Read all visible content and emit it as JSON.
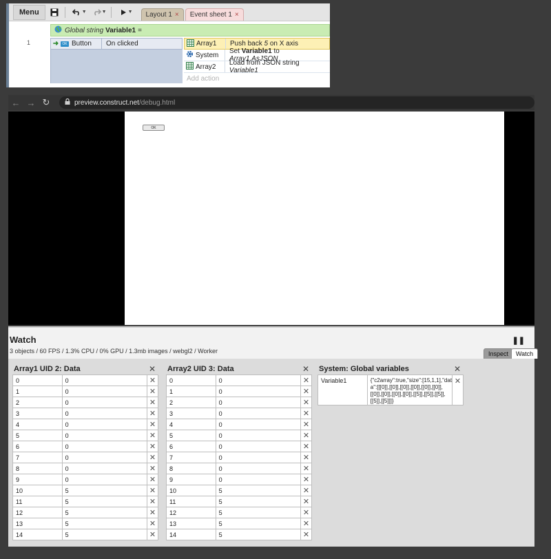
{
  "editor": {
    "menu_label": "Menu",
    "tabs": [
      {
        "label": "Layout 1"
      },
      {
        "label": "Event sheet 1"
      }
    ],
    "tab_close_glyph": "×",
    "global_var": {
      "prefix": "Global string",
      "name": "Variable1",
      "suffix": "="
    },
    "event": {
      "number": "1",
      "condition": {
        "object": "Button",
        "icon_label": "OK",
        "text": "On clicked"
      },
      "actions": [
        {
          "object": "Array1",
          "icon": "array-icon",
          "pre": "Push back",
          "mid": "5",
          "post": "on X axis"
        },
        {
          "object": "System",
          "icon": "gear-icon",
          "pre": "Set",
          "mid": "Variable1",
          "post": "to",
          "expr": "Array1.AsJSON"
        },
        {
          "object": "Array2",
          "icon": "array-icon",
          "pre": "Load from JSON string",
          "expr": "Variable1"
        }
      ],
      "add_action": "Add action"
    }
  },
  "browser": {
    "url_host": "preview.construct.net",
    "url_path": "/debug.html",
    "game_button_label": "OK"
  },
  "debugger": {
    "title": "Watch",
    "stats": "3 objects / 60 FPS / 1.3% CPU / 0% GPU / 1.3mb images / webgl2 / Worker",
    "tabs": {
      "inspect": "Inspect",
      "watch": "Watch"
    },
    "close_glyph": "✕",
    "panels": [
      {
        "title": "Array1 UID 2: Data",
        "rows": [
          {
            "k": "0",
            "v": "0"
          },
          {
            "k": "1",
            "v": "0"
          },
          {
            "k": "2",
            "v": "0"
          },
          {
            "k": "3",
            "v": "0"
          },
          {
            "k": "4",
            "v": "0"
          },
          {
            "k": "5",
            "v": "0"
          },
          {
            "k": "6",
            "v": "0"
          },
          {
            "k": "7",
            "v": "0"
          },
          {
            "k": "8",
            "v": "0"
          },
          {
            "k": "9",
            "v": "0"
          },
          {
            "k": "10",
            "v": "5"
          },
          {
            "k": "11",
            "v": "5"
          },
          {
            "k": "12",
            "v": "5"
          },
          {
            "k": "13",
            "v": "5"
          },
          {
            "k": "14",
            "v": "5"
          }
        ]
      },
      {
        "title": "Array2 UID 3: Data",
        "rows": [
          {
            "k": "0",
            "v": "0"
          },
          {
            "k": "1",
            "v": "0"
          },
          {
            "k": "2",
            "v": "0"
          },
          {
            "k": "3",
            "v": "0"
          },
          {
            "k": "4",
            "v": "0"
          },
          {
            "k": "5",
            "v": "0"
          },
          {
            "k": "6",
            "v": "0"
          },
          {
            "k": "7",
            "v": "0"
          },
          {
            "k": "8",
            "v": "0"
          },
          {
            "k": "9",
            "v": "0"
          },
          {
            "k": "10",
            "v": "5"
          },
          {
            "k": "11",
            "v": "5"
          },
          {
            "k": "12",
            "v": "5"
          },
          {
            "k": "13",
            "v": "5"
          },
          {
            "k": "14",
            "v": "5"
          }
        ]
      }
    ],
    "globals": {
      "title": "System: Global variables",
      "rows": [
        {
          "k": "Variable1",
          "v": "{\"c2array\":true,\"size\":[15,1,1],\"data\":[[[0]],[[0]],[[0]],[[0]],[[0]],[[0]],[[0]],[[0]],[[0]],[[0]],[[5]],[[5]],[[5]],[[5]],[[5]]]}"
        }
      ]
    }
  }
}
